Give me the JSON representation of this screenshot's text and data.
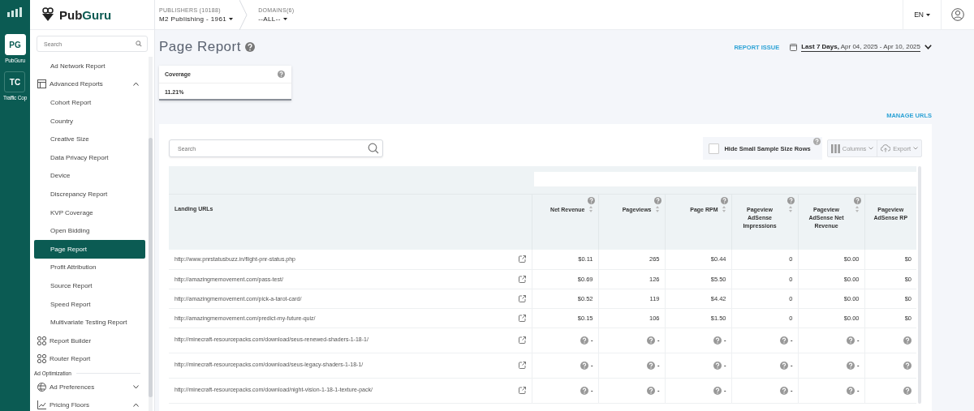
{
  "rail": {
    "apps": [
      {
        "initials": "PG",
        "label": "PubGuru",
        "selected": true
      },
      {
        "initials": "TC",
        "label": "Traffic Cop",
        "selected": false
      }
    ]
  },
  "brand": {
    "name_a": "Pub",
    "name_b": "Guru"
  },
  "breadcrumbs": [
    {
      "label": "PUBLISHERS (10188)",
      "value": "M2 Publishing - 1961"
    },
    {
      "label": "DOMAINS(6)",
      "value": "--ALL--"
    }
  ],
  "language": "EN",
  "sidebar": {
    "search": {
      "placeholder": "Search"
    },
    "items": [
      {
        "kind": "link",
        "label": "Ad Network Report",
        "selected": false
      },
      {
        "kind": "group",
        "label": "Advanced Reports",
        "expanded": true
      },
      {
        "kind": "link",
        "label": "Cohort Report",
        "selected": false
      },
      {
        "kind": "link",
        "label": "Country",
        "selected": false
      },
      {
        "kind": "link",
        "label": "Creative Size",
        "selected": false
      },
      {
        "kind": "link",
        "label": "Data Privacy Report",
        "selected": false
      },
      {
        "kind": "link",
        "label": "Device",
        "selected": false
      },
      {
        "kind": "link",
        "label": "Discrepancy Report",
        "selected": false
      },
      {
        "kind": "link",
        "label": "KVP Coverage",
        "selected": false
      },
      {
        "kind": "link",
        "label": "Open Bidding",
        "selected": false
      },
      {
        "kind": "link",
        "label": "Page Report",
        "selected": true
      },
      {
        "kind": "link",
        "label": "Profit Attribution",
        "selected": false
      },
      {
        "kind": "link",
        "label": "Source Report",
        "selected": false
      },
      {
        "kind": "link",
        "label": "Speed Report",
        "selected": false
      },
      {
        "kind": "link",
        "label": "Multivariate Testing Report",
        "selected": false
      },
      {
        "kind": "page",
        "label": "Report Builder"
      },
      {
        "kind": "page",
        "label": "Router Report"
      },
      {
        "kind": "section",
        "label": "Ad Optimization"
      },
      {
        "kind": "group",
        "label": "Ad Preferences",
        "expanded": false
      },
      {
        "kind": "group",
        "label": "Pricing Floors",
        "expanded": true
      }
    ]
  },
  "page": {
    "title": "Page Report",
    "report_issue": "REPORT ISSUE",
    "date_range": {
      "preset": "Last 7 Days,",
      "dates": "Apr 04, 2025 - Apr 10, 2025"
    },
    "metric_card": {
      "label": "Coverage",
      "value": "11.21%"
    },
    "manage_urls": "MANAGE URLS"
  },
  "table_tools": {
    "search": {
      "placeholder": "Search"
    },
    "hide_small_sample": {
      "label": "Hide Small Sample Size Rows",
      "checked": false
    },
    "columns_button": "Columns",
    "export_button": "Export"
  },
  "table": {
    "columns": [
      "Landing URLs",
      "Net Revenue",
      "Pageviews",
      "Page RPM",
      "Pageview AdSense Impressions",
      "Pageview AdSense Net Revenue",
      "Pageview AdSense RP"
    ],
    "rows": [
      {
        "missing": false,
        "cells": [
          "http://www.pnrstatusbuzz.in/flight-pnr-status.php",
          "$0.11",
          "265",
          "$0.44",
          "0",
          "$0.00",
          "$0"
        ]
      },
      {
        "missing": false,
        "cells": [
          "http://amazingmemovement.com/pass-test/",
          "$0.69",
          "126",
          "$5.50",
          "0",
          "$0.00",
          "$0"
        ]
      },
      {
        "missing": false,
        "cells": [
          "http://amazingmemovement.com/pick-a-tarot-card/",
          "$0.52",
          "119",
          "$4.42",
          "0",
          "$0.00",
          "$0"
        ]
      },
      {
        "missing": false,
        "cells": [
          "http://amazingmemovement.com/predict-my-future-quiz/",
          "$0.15",
          "106",
          "$1.50",
          "0",
          "$0.00",
          "$0"
        ]
      },
      {
        "missing": true,
        "cells": [
          "http://minecraft-resourcepacks.com/download/seus-renewed-shaders-1-18-1/",
          "-",
          "-",
          "-",
          "-",
          "-"
        ]
      },
      {
        "missing": true,
        "cells": [
          "http://minecraft-resourcepacks.com/download/seus-legacy-shaders-1-18-1/",
          "-",
          "-",
          "-",
          "-",
          "-"
        ]
      },
      {
        "missing": true,
        "cells": [
          "http://minecraft-resourcepacks.com/download/night-vision-1-18-1-texture-pack/",
          "-",
          "-",
          "-",
          "-",
          "-"
        ]
      }
    ]
  }
}
